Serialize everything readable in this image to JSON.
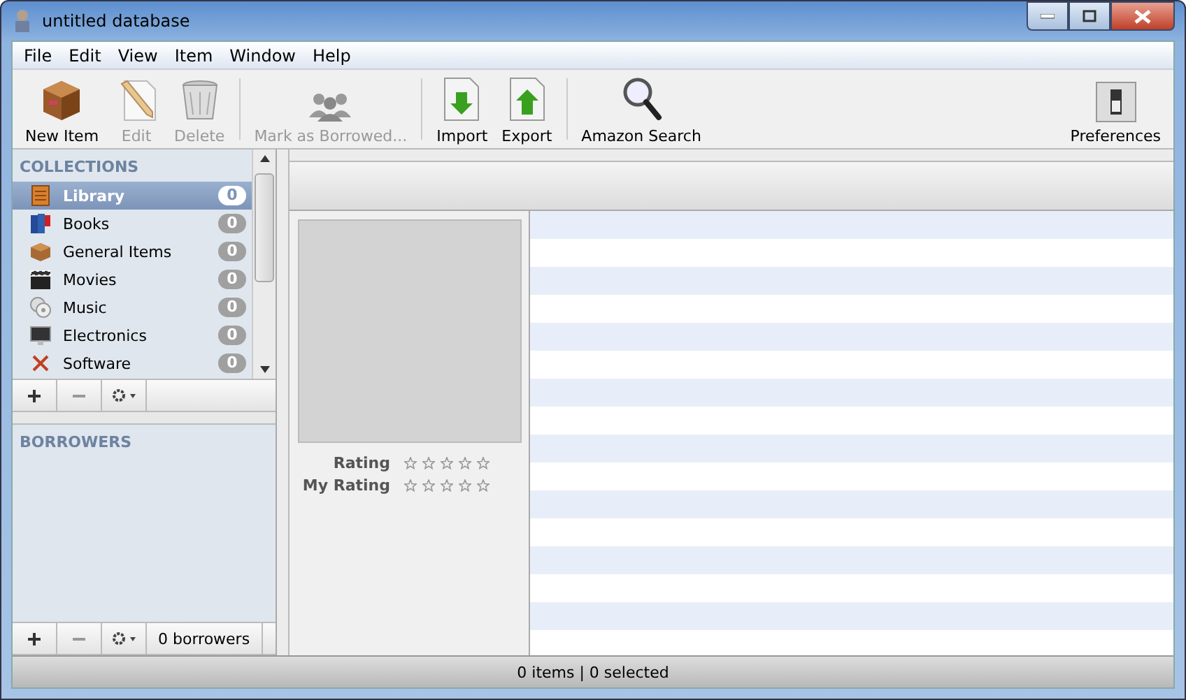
{
  "window": {
    "title": "untitled database"
  },
  "menu": [
    "File",
    "Edit",
    "View",
    "Item",
    "Window",
    "Help"
  ],
  "toolbar": [
    {
      "label": "New Item",
      "kind": "box",
      "disabled": false
    },
    {
      "label": "Edit",
      "kind": "pencil",
      "disabled": true
    },
    {
      "label": "Delete",
      "kind": "trash",
      "disabled": true
    },
    {
      "label": "Mark as Borrowed...",
      "kind": "people",
      "disabled": true
    },
    {
      "label": "Import",
      "kind": "import",
      "disabled": false
    },
    {
      "label": "Export",
      "kind": "export",
      "disabled": false
    },
    {
      "label": "Amazon Search",
      "kind": "search",
      "disabled": false
    },
    {
      "label": "Preferences",
      "kind": "switch",
      "disabled": false
    }
  ],
  "collections": {
    "header": "COLLECTIONS",
    "items": [
      {
        "label": "Library",
        "count": "0",
        "kind": "library",
        "selected": true
      },
      {
        "label": "Books",
        "count": "0",
        "kind": "books",
        "selected": false
      },
      {
        "label": "General Items",
        "count": "0",
        "kind": "box",
        "selected": false
      },
      {
        "label": "Movies",
        "count": "0",
        "kind": "movies",
        "selected": false
      },
      {
        "label": "Music",
        "count": "0",
        "kind": "music",
        "selected": false
      },
      {
        "label": "Electronics",
        "count": "0",
        "kind": "electronics",
        "selected": false
      },
      {
        "label": "Software",
        "count": "0",
        "kind": "software",
        "selected": false
      }
    ]
  },
  "borrowers": {
    "header": "BORROWERS",
    "count": "0 borrowers"
  },
  "ratings": [
    {
      "label": "Rating",
      "stars": 0
    },
    {
      "label": "My Rating",
      "stars": 0
    }
  ],
  "status_bar": "0 items | 0 selected"
}
